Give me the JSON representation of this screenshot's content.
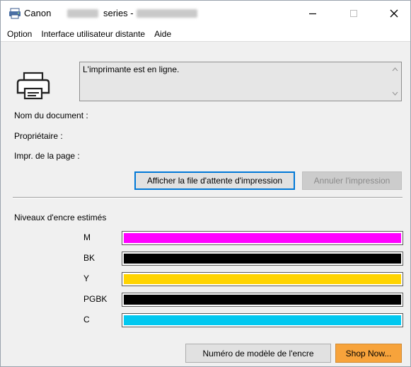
{
  "window": {
    "title_brand": "Canon",
    "title_series": "series -"
  },
  "menu": [
    {
      "label": "Option"
    },
    {
      "label": "Interface utilisateur distante"
    },
    {
      "label": "Aide"
    }
  ],
  "status": {
    "message": "L'imprimante est en ligne."
  },
  "info": {
    "document_label": "Nom du document :",
    "owner_label": "Propriétaire :",
    "page_label": "Impr. de la page :"
  },
  "buttons": {
    "queue": "Afficher la file d'attente d'impression",
    "cancel": "Annuler l'impression",
    "model": "Numéro de modèle de l'encre",
    "shop": "Shop Now..."
  },
  "ink": {
    "heading": "Niveaux d'encre estimés",
    "tanks": [
      {
        "name": "M",
        "color": "#ff00ff",
        "level": 1.0
      },
      {
        "name": "BK",
        "color": "#000000",
        "level": 1.0
      },
      {
        "name": "Y",
        "color": "#ffd400",
        "level": 1.0
      },
      {
        "name": "PGBK",
        "color": "#000000",
        "level": 1.0
      },
      {
        "name": "C",
        "color": "#00c8f0",
        "level": 1.0
      }
    ]
  }
}
